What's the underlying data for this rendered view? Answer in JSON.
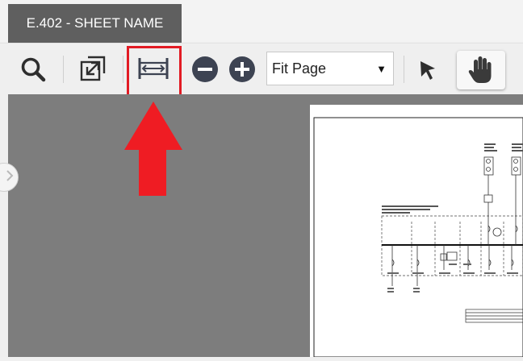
{
  "tab": {
    "title": "E.402 - SHEET NAME"
  },
  "toolbar": {
    "zoom_select": {
      "value": "Fit Page"
    },
    "icons": [
      "search-icon",
      "expand-icon",
      "fit-width-icon",
      "zoom-out-icon",
      "zoom-in-icon",
      "pointer-icon",
      "pan-hand-icon"
    ]
  },
  "colors": {
    "tab_bg": "#5f5f5f",
    "highlight": "#e21b24",
    "viewer_bg": "#7d7d7d"
  }
}
